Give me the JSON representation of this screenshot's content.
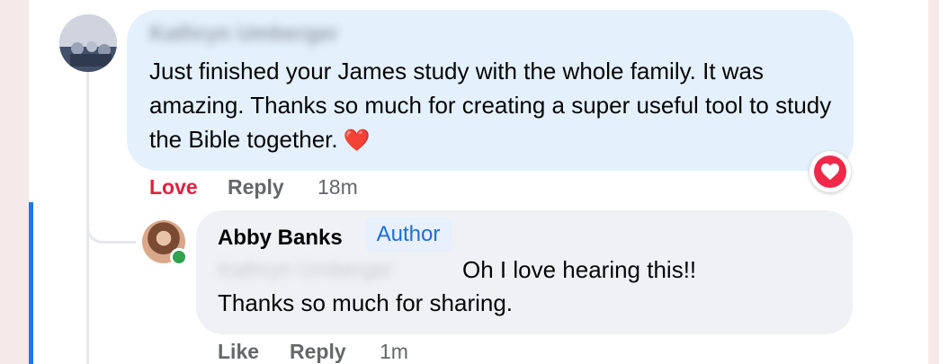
{
  "comment": {
    "author_name": "Kathryn Umberger",
    "text": "Just finished your James study with the whole family. It was amazing. Thanks so much for creating a super useful tool to study the Bible together.",
    "emoji": "❤️",
    "reaction_label": "Love",
    "reply_label": "Reply",
    "time": "18m",
    "reaction_icon": "heart-icon"
  },
  "reply": {
    "author_name": "Abby Banks",
    "badge": "Author",
    "mention": "Kathryn Umberger",
    "text_line1": "Oh I love hearing this!!",
    "text_line2": "Thanks so much for sharing.",
    "like_label": "Like",
    "reply_label": "Reply",
    "time": "1m"
  },
  "colors": {
    "accent": "#1877f2",
    "love": "#e41e3f",
    "comment_bubble": "#e4f1fd",
    "reply_bubble": "#f0f1f5"
  }
}
